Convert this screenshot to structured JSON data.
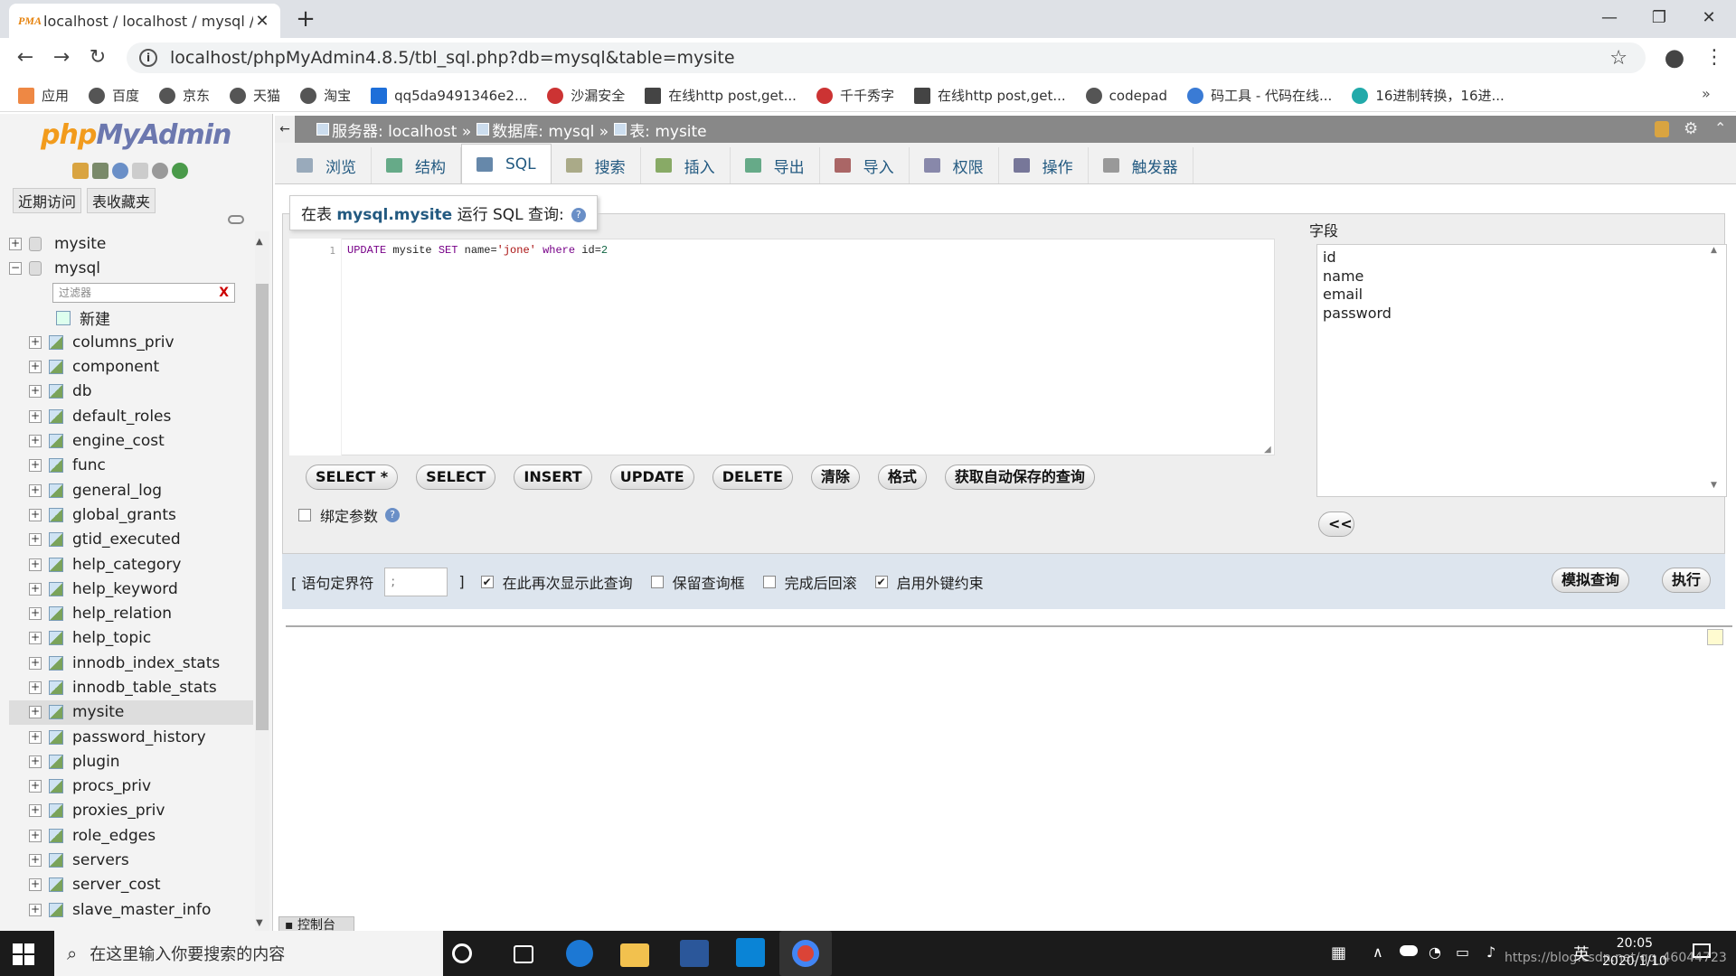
{
  "browser": {
    "tab_title": "localhost / localhost / mysql /",
    "url": "localhost/phpMyAdmin4.8.5/tbl_sql.php?db=mysql&table=mysite",
    "bookmarks": [
      "应用",
      "百度",
      "京东",
      "天猫",
      "淘宝",
      "qq5da9491346e2...",
      "沙漏安全",
      "在线http post,get...",
      "千千秀字",
      "在线http post,get...",
      "codepad",
      "码工具 - 代码在线...",
      "16进制转换，16进..."
    ],
    "more": "»"
  },
  "nav": {
    "logo_php": "php",
    "logo_myadmin": "MyAdmin",
    "tab_recent": "近期访问",
    "tab_favorites": "表收藏夹",
    "db1": "mysite",
    "db2": "mysql",
    "filter_placeholder": "过滤器",
    "new_label": "新建",
    "tables": [
      "columns_priv",
      "component",
      "db",
      "default_roles",
      "engine_cost",
      "func",
      "general_log",
      "global_grants",
      "gtid_executed",
      "help_category",
      "help_keyword",
      "help_relation",
      "help_topic",
      "innodb_index_stats",
      "innodb_table_stats",
      "mysite",
      "password_history",
      "plugin",
      "procs_priv",
      "proxies_priv",
      "role_edges",
      "servers",
      "server_cost",
      "slave_master_info"
    ]
  },
  "breadcrumb": {
    "server": "服务器: localhost »",
    "database": "数据库: mysql »",
    "table": "表: mysite"
  },
  "menu": {
    "tabs": [
      "浏览",
      "结构",
      "SQL",
      "搜索",
      "插入",
      "导出",
      "导入",
      "权限",
      "操作",
      "触发器"
    ]
  },
  "sql": {
    "legend_prefix": "在表 ",
    "legend_table": "mysql.mysite",
    "legend_suffix": " 运行 SQL 查询:",
    "line_no": "1",
    "buttons": [
      "SELECT *",
      "SELECT",
      "INSERT",
      "UPDATE",
      "DELETE",
      "清除",
      "格式",
      "获取自动保存的查询"
    ],
    "bind_params": "绑定参数",
    "fields_label": "字段",
    "fields": [
      "id",
      "name",
      "email",
      "password"
    ],
    "insert_button": "<<",
    "delimiter_label": "[ 语句定界符",
    "delimiter_value": ";",
    "delimiter_close": "]",
    "options": [
      {
        "label": "在此再次显示此查询",
        "checked": true
      },
      {
        "label": "保留查询框",
        "checked": false
      },
      {
        "label": "完成后回滚",
        "checked": false
      },
      {
        "label": "启用外键约束",
        "checked": true
      }
    ],
    "simulate_button": "模拟查询",
    "execute_button": "执行"
  },
  "console_label": "控制台",
  "taskbar": {
    "search_placeholder": "在这里输入你要搜索的内容",
    "time": "20:05",
    "date": "2020/1/10",
    "ime": "英",
    "watermark": "https://blog.csdn.net/qq_46044723"
  }
}
